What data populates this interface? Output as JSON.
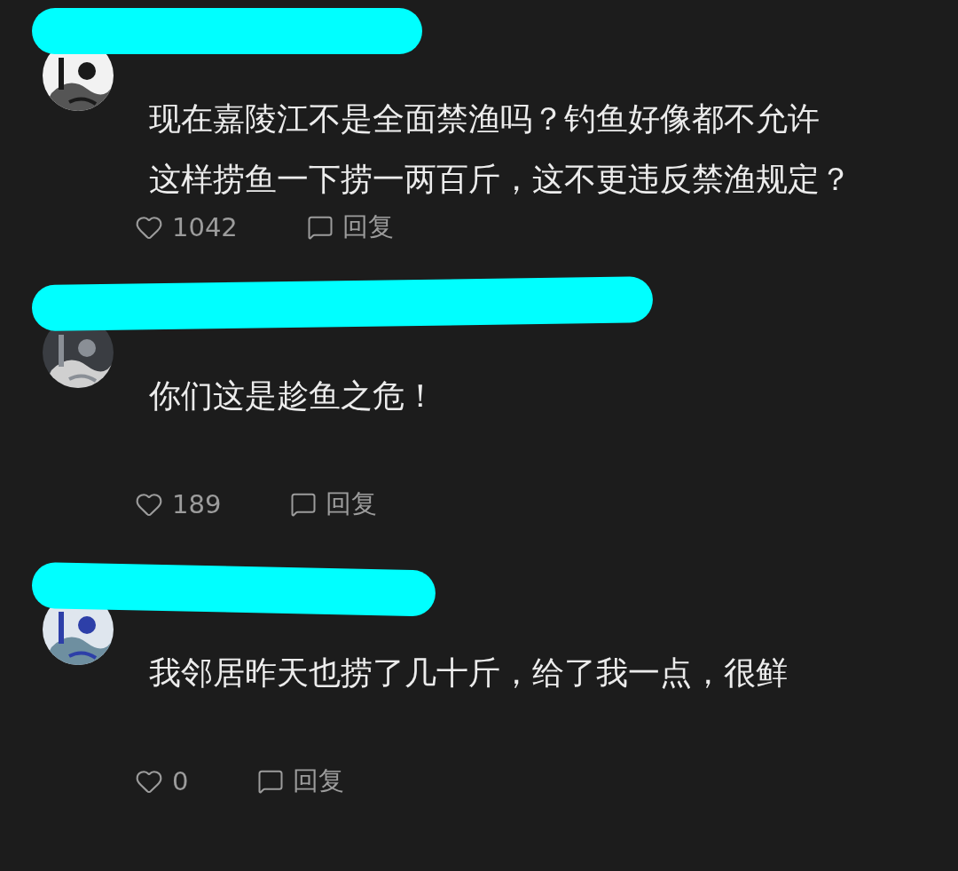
{
  "comments": [
    {
      "lines": [
        "现在嘉陵江不是全面禁渔吗？钓鱼好像都不允许",
        "这样捞鱼一下捞一两百斤，这不更违反禁渔规定？"
      ],
      "likes": "1042",
      "reply": "回复"
    },
    {
      "lines": [
        "你们这是趁鱼之危！"
      ],
      "likes": "189",
      "reply": "回复"
    },
    {
      "lines": [
        "我邻居昨天也捞了几十斤，给了我一点，很鲜"
      ],
      "likes": "0",
      "reply": "回复"
    }
  ]
}
